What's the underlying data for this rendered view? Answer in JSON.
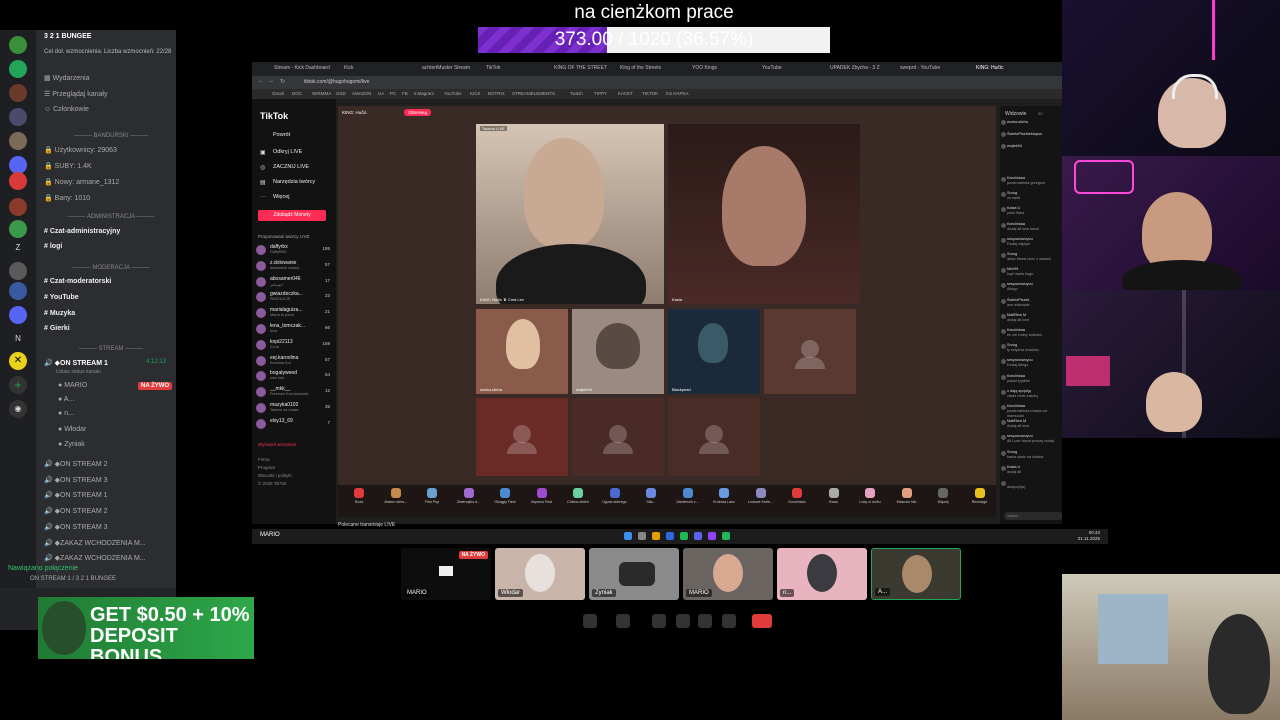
{
  "overlay": {
    "goal_title": "na cienżkom prace",
    "goal_progress": "373.00 / 1020 (36.57%)",
    "goal_fraction": 0.3657
  },
  "discord": {
    "server_name": "3 2 1 BUNGEE",
    "boost_text": "Cel doł. wzmocnienia: Liczba wzmocnień: 22/28",
    "top_items": [
      "Wydarzenia",
      "Przeglądaj kanały",
      "Członkowie"
    ],
    "section_bandurski": "BANDURSKI",
    "stats": [
      "Użytkownicy: 29063",
      "SUBY: 1.4K",
      "Nowy: armane_1312",
      "Bany: 1010"
    ],
    "section_admin": "ADMINISTRACJA",
    "admin_channels": [
      "Czat-administracyjny",
      "logi"
    ],
    "section_mod": "MODERACJA",
    "mod_channels": [
      "Czat-moderatorski",
      "YouTube",
      "Muzyka",
      "Gierki"
    ],
    "section_stream": "STREAM",
    "stream_channel": "ON STREAM 1",
    "stream_channel_time": "4:12:13",
    "stream_channel_sub": "Ustaw status kanału",
    "voice_members": [
      "MARIO",
      "A...",
      "n...",
      "Włodar",
      "Zyniak"
    ],
    "live_badge": "NA ŻYWO",
    "other_streams": [
      "ON STREAM 2",
      "ON STREAM 3",
      "ON STREAM 1",
      "ON STREAM 2",
      "ON STREAM 3",
      "ZAKAZ WCHODZENIA M...",
      "ZAKAZ WCHODZENIA M..."
    ],
    "connection_status": "Nawiązano połączenie",
    "connection_sub": "ON STREAM 1 / 3 2 1 BUNGEE",
    "server_icon_letters": [
      "Z",
      "N"
    ]
  },
  "ad": {
    "text": "GET $0.50 + 10% DEPOSIT BONUS"
  },
  "browser": {
    "tabs": [
      "Stream - Kick Dashboard",
      "Kick",
      "achtertMuster Stream",
      "TikTok",
      "KING OF THE STREET",
      "King of the Streets",
      "YOO Kings",
      "YouTube",
      "UPADEK Zbycha - 3 Z",
      "sweprd - YouTube",
      "KING: Hučic"
    ],
    "url": "tiktok.com/@hugohugomi/live",
    "bookmarks": [
      "Gmail",
      "DOC",
      "WIRMMA",
      "GSD",
      "AMAZON",
      "UA",
      "PC",
      "FB",
      "Instagram",
      "YouTube",
      "KICK",
      "BOTRIX",
      "STREAMELEMENTS",
      "Twitch",
      "TIPPY",
      "KACET",
      "TIKTOK",
      "KS HAPKA"
    ]
  },
  "tiktok": {
    "logo": "TikTok",
    "nav": [
      "Powrót",
      "Odkryj LIVE",
      "ZACZNIJ LIVE",
      "Narzędzia twórcy",
      "Więcej"
    ],
    "money_button": "Zdobądź Monety",
    "suggested_header": "Proponowani twórcy LIVE",
    "creators": [
      {
        "name": "daffyrbx",
        "sub": "DaffyRBX",
        "count": "185"
      },
      {
        "name": "z.dolowanie",
        "sub": "dołowanie sztany",
        "count": "57"
      },
      {
        "name": "abosamer046",
        "sub": "ابوسامر",
        "count": "17"
      },
      {
        "name": "gwiazdeczka...",
        "sub": "ŚMIGAJCIE",
        "count": "23"
      },
      {
        "name": "marialaguiza...",
        "sub": "María la pieza",
        "count": "21"
      },
      {
        "name": "lena_tomczak...",
        "sub": "lena",
        "count": "66"
      },
      {
        "name": "kopi22113",
        "sub": "Co tu",
        "count": "169"
      },
      {
        "name": "eej.karoolina",
        "sub": "Karolina Kot",
        "count": "57"
      },
      {
        "name": "bogatyweed",
        "sub": "kice hey",
        "count": "64"
      },
      {
        "name": "__mkk__",
        "sub": "Przemek Kochanowski",
        "count": "12"
      },
      {
        "name": "mazyka0102",
        "sub": "Tasiem na masie",
        "count": "35"
      },
      {
        "name": "elsy13_69",
        "sub": "",
        "count": "7"
      }
    ],
    "see_all": "Wyświetl wszystkie",
    "footer": [
      "Firma",
      "Program",
      "Warunki i polityki",
      "© 2025 TikTok"
    ],
    "host_name": "KING: Hučic",
    "follow": "Obserwuj",
    "cam_tags": [
      "Twórca LIVE",
      "KING: Hučic ♛ Cmd.Lev"
    ],
    "cam_right_tag": "Kasia",
    "guest_labels": [
      "worka.slicha",
      "wojtek94",
      "Blackpearl"
    ],
    "recommend": "Polecane transmisje LIVE",
    "gifts": [
      "Róża",
      "Jestem stres...",
      "First Pop",
      "Zwierzątko d...",
      "Okrągły Fiest",
      "Imprezo Fest",
      "Chleba zieleń",
      "Ujęcia dobrego",
      "Siła...",
      "Zamiennik z...",
      "Królowa Lasu",
      "Ludowe Króle...",
      "Korzeńska",
      "Kwas",
      "Lody w rożku",
      "Mascolo Nio",
      "Więcej",
      "Recharge"
    ],
    "chat_header": "Widzowie",
    "chat_header_count": "30",
    "viewers": [
      "worka.slicha",
      "ŚwietoPiszMektopus",
      "wojtek94"
    ],
    "chat": [
      {
        "user": "Karolinkaa",
        "text": "pozdrowienia grzegorz"
      },
      {
        "user": "Sroog",
        "text": "ok kanit"
      },
      {
        "user": "Kasia U",
        "text": "poko flaka"
      },
      {
        "user": "Karolinkaa",
        "text": "dodaj ali love band"
      },
      {
        "user": "sesyowowoyou",
        "text": "Dodaj zapięto"
      },
      {
        "user": "Sroog",
        "text": "allow bland choc z warack"
      },
      {
        "user": "Mini99",
        "text": "kop! walla hugo"
      },
      {
        "user": "sesyowowoyou",
        "text": "Allego"
      },
      {
        "user": "ŚwieloPiszek",
        "text": "ave widzowie"
      },
      {
        "user": "MattRew M",
        "text": "dodaj ali love"
      },
      {
        "user": "Karolinkaa",
        "text": "en cie rodny kotkami"
      },
      {
        "user": "Sroog",
        "text": "ty szlyena moskloz"
      },
      {
        "user": "sesyowowoyou",
        "text": "Dodaj Allego"
      },
      {
        "user": "Karolinkaa",
        "text": "pokaż łyjabke"
      },
      {
        "user": "o dają spojziję",
        "text": "zaraz mnie założą"
      },
      {
        "user": "Karolinkaa",
        "text": "pozdrowienia macka od mamuszki"
      },
      {
        "user": "MattRew M",
        "text": "dodaj ali love"
      },
      {
        "user": "sesyowowoyou",
        "text": "Ali Love bland proszę dodaj"
      },
      {
        "user": "Sroog",
        "text": "kasia siadz na kolana"
      },
      {
        "user": "Kasia U",
        "text": "dodaj ali"
      },
      {
        "user": "",
        "text": "dołączył(a)"
      }
    ],
    "chat_input": "Wpisz..."
  },
  "taskbar": {
    "label": "MARIO",
    "time": "00:43",
    "date": "21.11.2025"
  },
  "call": {
    "tiles": [
      "MARIO",
      "Włodar",
      "Zyniak",
      "MARIO",
      "n...",
      "A..."
    ],
    "tile_live": "NA ŻYWO"
  },
  "colors": {
    "purple": "#7d2fd0",
    "tiktok_red": "#fe2c55",
    "discord_green": "#33c46f",
    "live_red": "#e23b3b"
  }
}
